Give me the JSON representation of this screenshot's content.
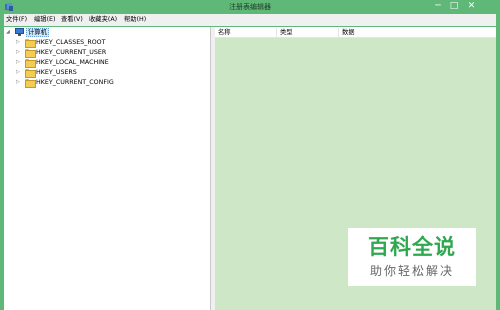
{
  "window": {
    "title": "注册表编辑器",
    "minimize_glyph": "─",
    "maximize_glyph": "□",
    "close_glyph": "✕"
  },
  "menu": {
    "items": [
      {
        "label": "文件(F)"
      },
      {
        "label": "编辑(E)"
      },
      {
        "label": "查看(V)"
      },
      {
        "label": "收藏夹(A)"
      },
      {
        "label": "帮助(H)"
      }
    ]
  },
  "tree": {
    "root": {
      "label": "计算机",
      "icon": "computer-icon",
      "expander": "◢"
    },
    "children": [
      {
        "label": "HKEY_CLASSES_ROOT",
        "icon": "folder-icon",
        "expander": "▷"
      },
      {
        "label": "HKEY_CURRENT_USER",
        "icon": "folder-icon",
        "expander": "▷"
      },
      {
        "label": "HKEY_LOCAL_MACHINE",
        "icon": "folder-icon",
        "expander": "▷"
      },
      {
        "label": "HKEY_USERS",
        "icon": "folder-icon",
        "expander": "▷"
      },
      {
        "label": "HKEY_CURRENT_CONFIG",
        "icon": "folder-icon",
        "expander": "▷"
      }
    ]
  },
  "list": {
    "columns": [
      "名称",
      "类型",
      "数据"
    ]
  },
  "watermark": {
    "main": "百科全说",
    "sub": "助你轻松解决"
  },
  "colors": {
    "frame": "#5fb878",
    "pane_background": "#cde7c7",
    "watermark_green": "#2fa84f"
  }
}
